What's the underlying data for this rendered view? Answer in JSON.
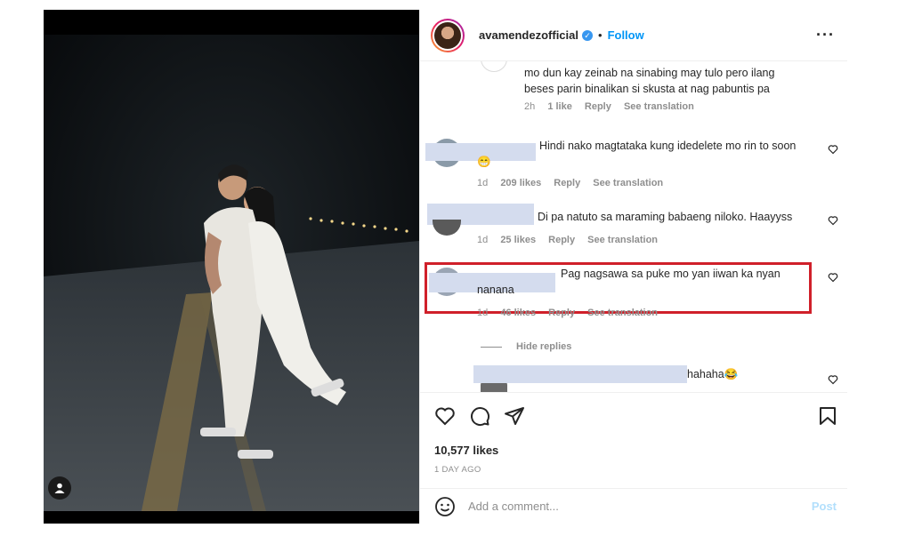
{
  "post": {
    "photo_alt_icon": "user-tag-icon"
  },
  "header": {
    "username": "avamendezofficial",
    "verified_icon": "verified-badge-icon",
    "separator": "•",
    "follow_label": "Follow",
    "more_icon": "ellipsis-icon"
  },
  "comments": [
    {
      "text": "mo dun kay zeinab na sinabing may tulo pero ilang beses parin binalikan si skusta at nag pabuntis pa",
      "time": "2h",
      "likes": "1 like",
      "reply": "Reply",
      "translate": "See translation"
    },
    {
      "text": "Hindi nako magtataka kung idedelete mo rin to soon 😁",
      "time": "1d",
      "likes": "209 likes",
      "reply": "Reply",
      "translate": "See translation"
    },
    {
      "text": "Di pa natuto sa maraming babaeng niloko. Haayyss",
      "time": "1d",
      "likes": "25 likes",
      "reply": "Reply",
      "translate": "See translation"
    },
    {
      "text": "Pag nagsawa sa puke mo yan iiwan ka nyan nanana",
      "time": "1d",
      "likes": "46 likes",
      "reply": "Reply",
      "translate": "See translation"
    },
    {
      "text": "hahaha😂"
    }
  ],
  "hide_replies_label": "Hide replies",
  "actions": {
    "like_icon": "heart-icon",
    "comment_icon": "comment-icon",
    "share_icon": "send-icon",
    "save_icon": "bookmark-icon",
    "likes_count": "10,577 likes",
    "posted": "1 DAY AGO"
  },
  "composer": {
    "emoji_icon": "emoji-icon",
    "placeholder": "Add a comment...",
    "post_label": "Post"
  },
  "colors": {
    "accent": "#0095f6",
    "highlight_border": "#d0202a"
  }
}
